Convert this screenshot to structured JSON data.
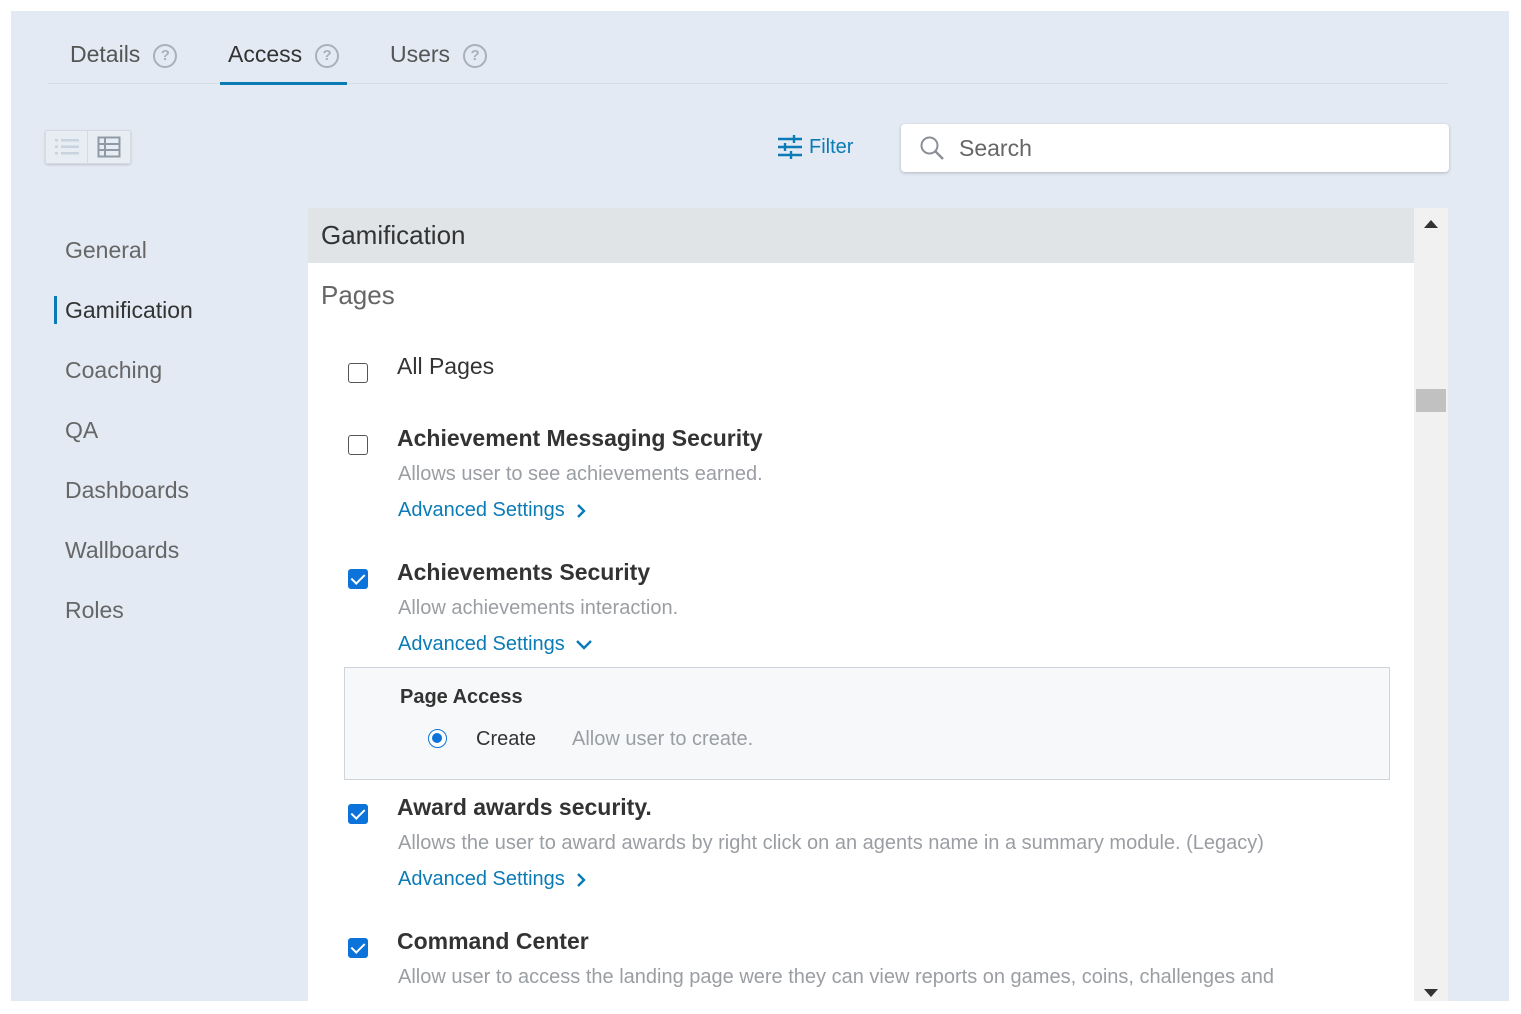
{
  "tabs": [
    {
      "label": "Details",
      "help": "?"
    },
    {
      "label": "Access",
      "help": "?"
    },
    {
      "label": "Users",
      "help": "?"
    }
  ],
  "toolbar": {
    "filter_label": "Filter",
    "search_placeholder": "Search"
  },
  "nav": {
    "items": [
      "General",
      "Gamification",
      "Coaching",
      "QA",
      "Dashboards",
      "Wallboards",
      "Roles"
    ],
    "active": "Gamification"
  },
  "content": {
    "section_title": "Gamification",
    "subheading": "Pages",
    "all_pages_label": "All Pages",
    "all_pages_checked": false,
    "items": [
      {
        "title": "Achievement Messaging Security",
        "description": "Allows user to see achievements earned.",
        "advanced_label": "Advanced Settings",
        "checked": false,
        "expanded": false
      },
      {
        "title": "Achievements Security",
        "description": "Allow achievements interaction.",
        "advanced_label": "Advanced Settings",
        "checked": true,
        "expanded": true,
        "advanced": {
          "section_title": "Page Access",
          "option_label": "Create",
          "option_description": "Allow user to create.",
          "option_selected": true
        }
      },
      {
        "title": "Award awards security.",
        "description": "Allows the user to award awards by right click on an agents name in a summary module. (Legacy)",
        "advanced_label": "Advanced Settings",
        "checked": true,
        "expanded": false
      },
      {
        "title": "Command Center",
        "description": "Allow user to access the landing page were they can view reports on games, coins, challenges and",
        "checked": true
      }
    ]
  },
  "colors": {
    "accent": "#0b7bb6",
    "checkbox": "#0b73d9",
    "panel_bg": "#e3eaf3",
    "section_header_bg": "#e1e4e7"
  }
}
